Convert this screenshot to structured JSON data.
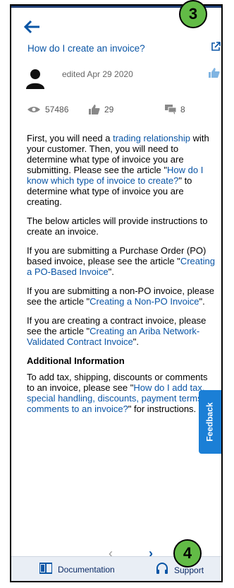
{
  "header": {
    "title": "How do I create an invoice?"
  },
  "badges": {
    "top": "3",
    "bottom": "4"
  },
  "author": {
    "edited": "edited Apr 29 2020"
  },
  "stats": {
    "views": "57486",
    "likes": "29",
    "comments": "8"
  },
  "article": {
    "p1_part1": "First, you will need a ",
    "p1_link1": "trading relationship",
    "p1_part2": " with your customer. Then, you will need to determine what type of invoice you are submitting. Please see the article \"",
    "p1_link2": "How do I know which type of invoice to create?",
    "p1_part3": "\" to determine what type of invoice you are creating.",
    "p2": "The below articles will provide instructions to create an invoice.",
    "p3_part1": "If you are submitting a Purchase Order (PO) based invoice, please see the article \"",
    "p3_link": "Creating a PO-Based Invoice",
    "p3_part2": "\".",
    "p4_part1": "If you are submitting a non-PO invoice, please see the article \"",
    "p4_link": "Creating a Non-PO Invoice",
    "p4_part2": "\".",
    "p5_part1": "If you are creating a contract invoice, please see the article \"",
    "p5_link": "Creating an Ariba Network-Validated Contract Invoice",
    "p5_part2": "\".",
    "section_title": "Additional Information",
    "p6_part1": "To add tax, shipping, discounts or comments to an invoice, please see \"",
    "p6_link": "How do I add tax, special handling, discounts, payment terms, or comments to an invoice?",
    "p6_part2": "\" for instructions."
  },
  "feedback": {
    "label": "Feedback"
  },
  "pager": {
    "prev": "‹",
    "next": "›"
  },
  "footer": {
    "documentation": "Documentation",
    "support": "Support"
  },
  "colors": {
    "link": "#0a55a5",
    "badge": "#62bb46",
    "feedback": "#1b7fd6"
  }
}
